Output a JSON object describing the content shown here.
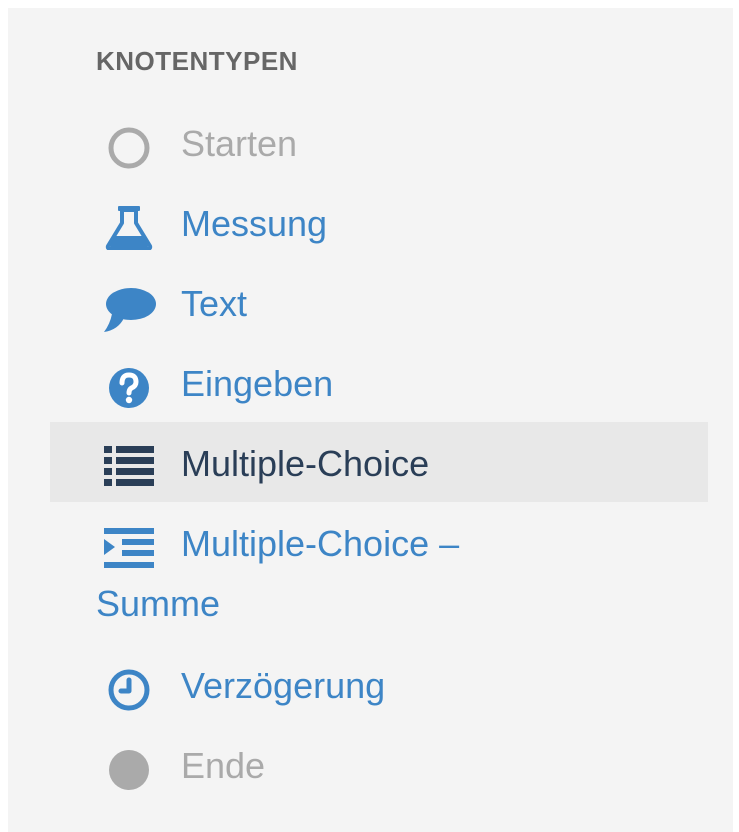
{
  "palette": {
    "panel_bg": "#f4f4f4",
    "link_blue": "#3d85c6",
    "disabled_gray": "#aaaaaa",
    "active_bg": "#e8e8e8",
    "active_text": "#2a3e57"
  },
  "sidebar": {
    "heading": "KNOTENTYPEN",
    "items": [
      {
        "label": "Starten",
        "icon": "circle-outline-icon",
        "state": "disabled"
      },
      {
        "label": "Messung",
        "icon": "flask-icon",
        "state": "link"
      },
      {
        "label": "Text",
        "icon": "speech-bubble-icon",
        "state": "link"
      },
      {
        "label": "Eingeben",
        "icon": "question-circle-icon",
        "state": "link"
      },
      {
        "label": "Multiple-Choice",
        "icon": "list-icon",
        "state": "active"
      },
      {
        "label": "Multiple-Choice –",
        "label_continued": "Summe",
        "icon": "indent-list-icon",
        "state": "link"
      },
      {
        "label": "Verzögerung",
        "icon": "clock-icon",
        "state": "link"
      },
      {
        "label": "Ende",
        "icon": "filled-circle-icon",
        "state": "disabled"
      }
    ]
  }
}
